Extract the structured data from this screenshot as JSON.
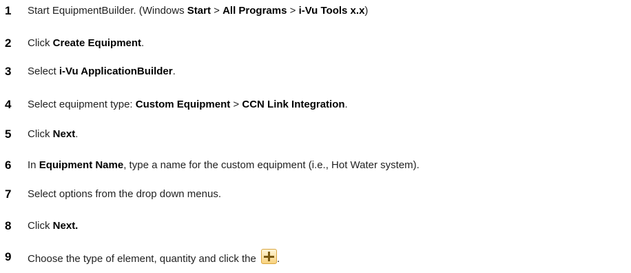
{
  "steps": [
    {
      "num": "1",
      "parts": [
        "Start EquipmentBuilder. (Windows ",
        "Start",
        " > ",
        "All Programs",
        " > ",
        "i-Vu Tools x.x",
        ")"
      ]
    },
    {
      "num": "2",
      "parts": [
        "Click ",
        "Create Equipment",
        "."
      ]
    },
    {
      "num": "3",
      "parts": [
        "Select ",
        "i-Vu ApplicationBuilder",
        "."
      ]
    },
    {
      "num": "4",
      "parts": [
        "Select equipment type: ",
        "Custom Equipment",
        " > ",
        "CCN Link Integration",
        "."
      ]
    },
    {
      "num": "5",
      "parts": [
        "Click ",
        "Next",
        "."
      ]
    },
    {
      "num": "6",
      "parts": [
        "In ",
        "Equipment Name",
        ", type a name for the custom equipment (i.e., Hot Water system)."
      ]
    },
    {
      "num": "7",
      "parts": [
        "Select options from the drop down menus."
      ]
    },
    {
      "num": "8",
      "parts": [
        "Click ",
        "Next."
      ]
    },
    {
      "num": "9",
      "parts": [
        "Choose the type of element, quantity and click the ",
        "."
      ]
    }
  ],
  "icons": {
    "step9": "add-plus-icon"
  }
}
